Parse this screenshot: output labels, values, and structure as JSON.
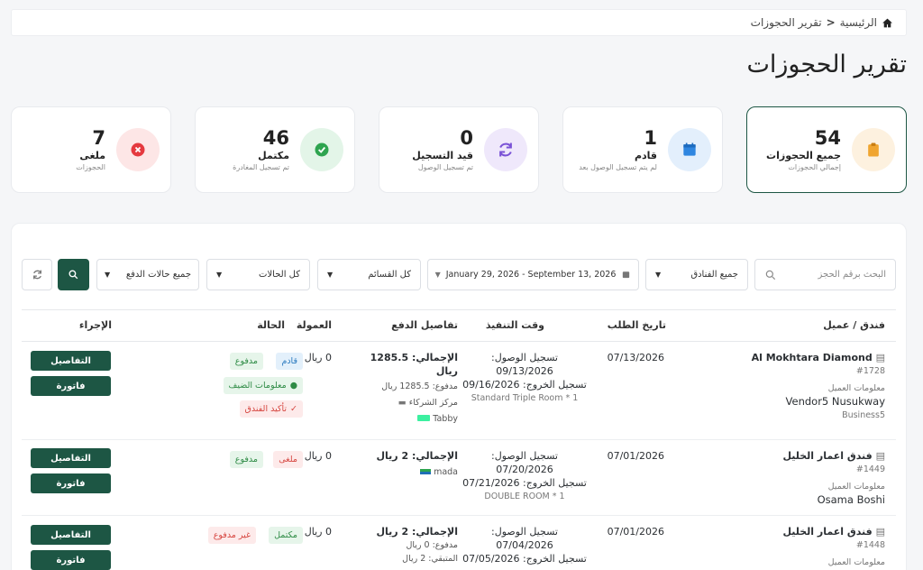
{
  "breadcrumb": {
    "home": "الرئيسية",
    "current": "تقرير الحجوزات"
  },
  "page_title": "تقرير الحجوزات",
  "stats": [
    {
      "value": "54",
      "label": "جميع الحجوزات",
      "sub": "إجمالي الحجوزات",
      "color": "#f0a530"
    },
    {
      "value": "1",
      "label": "قادم",
      "sub": "لم يتم تسجيل الوصول بعد",
      "color": "#2f86e0"
    },
    {
      "value": "0",
      "label": "قيد التسجيل",
      "sub": "تم تسجيل الوصول",
      "color": "#7a52d6"
    },
    {
      "value": "46",
      "label": "مكتمل",
      "sub": "تم تسجيل المغادرة",
      "color": "#2ea44f"
    },
    {
      "value": "7",
      "label": "ملغى",
      "sub": "الحجوزات",
      "color": "#e5393f"
    }
  ],
  "filters": {
    "search_placeholder": "البحث برقم الحجز",
    "hotels": "جميع الفنادق",
    "date_range": "January 29, 2026 - September 13, 2026",
    "sections": "كل القسائم",
    "statuses": "كل الحالات",
    "payment_statuses": "جميع حالات الدفع"
  },
  "table": {
    "headers": {
      "hotel": "فندق / عميل",
      "request_date": "تاريخ الطلب",
      "execution": "وقت التنفيذ",
      "payment": "تفاصيل الدفع",
      "commission": "العمولة",
      "status": "الحالة",
      "action": "الإجراء"
    },
    "buttons": {
      "details": "التفاصيل",
      "invoice": "فاتورة"
    },
    "rows": [
      {
        "hotel": "Al Mokhtara Diamond",
        "id": "#1728",
        "client_info": "معلومات العميل",
        "client": "Vendor5 Nusukway",
        "client_sub": "Business5",
        "request_date": "07/13/2026",
        "checkin_label": "تسجيل الوصول:",
        "checkin": "09/13/2026",
        "checkout": "تسجيل الخروج: 09/16/2026",
        "room": "Standard Triple Room * 1",
        "total1": "الإجمالي: 1285.5",
        "total2": "ريال",
        "paid": "مدفوع: 1285.5 ريال",
        "partner": "مركز الشركاء",
        "method": "Tabby",
        "commission": "0 ريال",
        "badge1": "قادم",
        "badge2": "مدفوع",
        "badge3": "معلومات الضيف",
        "badge4": "تأكيد الفندق"
      },
      {
        "hotel": "فندق اعمار الخليل",
        "id": "#1449",
        "client_info": "معلومات العميل",
        "client": "Osama Boshi",
        "request_date": "07/01/2026",
        "checkin_label": "تسجيل الوصول:",
        "checkin": "07/20/2026",
        "checkout": "تسجيل الخروج: 07/21/2026",
        "room": "DOUBLE ROOM * 1",
        "total": "الإجمالي: 2 ريال",
        "method": "mada",
        "commission": "0 ريال",
        "badge1": "ملغى",
        "badge2": "مدفوع"
      },
      {
        "hotel": "فندق اعمار الخليل",
        "id": "#1448",
        "client_info": "معلومات العميل",
        "request_date": "07/01/2026",
        "checkin_label": "تسجيل الوصول:",
        "checkin": "07/04/2026",
        "checkout": "تسجيل الخروج: 07/05/2026",
        "total": "الإجمالي: 2 ريال",
        "paid": "مدفوع: 0 ريال",
        "remaining": "المتبقي: 2 ريال",
        "commission": "0 ريال",
        "badge1": "مكتمل",
        "badge2": "غير مدفوع"
      }
    ]
  }
}
